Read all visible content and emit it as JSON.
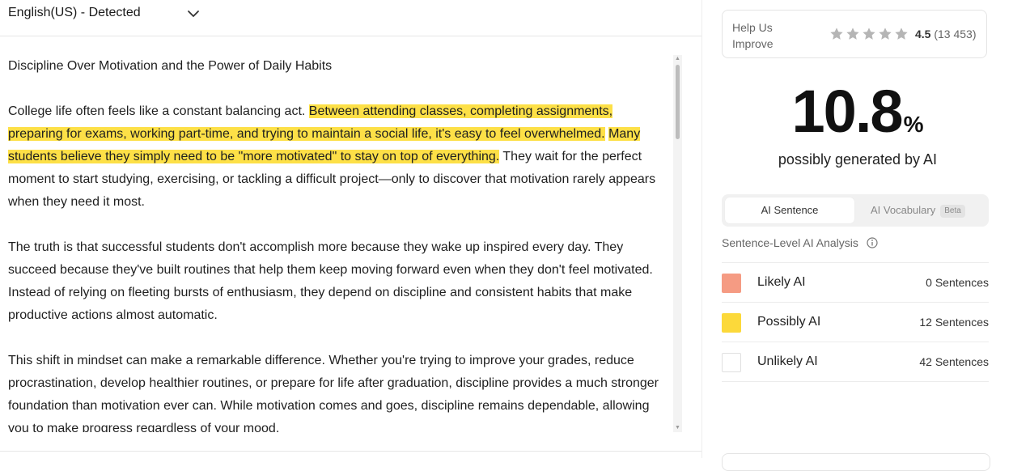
{
  "language": {
    "label": "English(US) - Detected"
  },
  "document": {
    "title": "Discipline Over Motivation and the Power of Daily Habits",
    "p1": {
      "s1": "College life often feels like a constant balancing act. ",
      "s2": "Between attending classes, completing assignments, preparing for exams, working part-time, and trying to maintain a social life, it's easy to feel overwhelmed.",
      "s3": " ",
      "s4": "Many students believe they simply need to be \"more motivated\" to stay on top of everything.",
      "s5": " They wait for the perfect moment to start studying, exercising, or tackling a difficult project—only to discover that motivation rarely appears when they need it most."
    },
    "p2": "The truth is that successful students don't accomplish more because they wake up inspired every day. They succeed because they've built routines that help them keep moving forward even when they don't feel motivated. Instead of relying on fleeting bursts of enthusiasm, they depend on discipline and consistent habits that make productive actions almost automatic.",
    "p3": "This shift in mindset can make a remarkable difference. Whether you're trying to improve your grades, reduce procrastination, develop healthier routines, or prepare for life after graduation, discipline provides a much stronger foundation than motivation ever can. While motivation comes and goes, discipline remains dependable, allowing you to make progress regardless of your mood."
  },
  "feedback": {
    "label": "Help Us Improve",
    "rating_value": "4.5",
    "rating_count": "(13 453)",
    "stars": 5,
    "star_color": "#b5b5b5"
  },
  "score": {
    "value": "10.8",
    "unit": "%",
    "caption": "possibly generated by AI"
  },
  "tabs": {
    "active": "AI Sentence",
    "inactive": "AI Vocabulary",
    "badge": "Beta"
  },
  "analysis": {
    "title": "Sentence-Level AI Analysis",
    "rows": [
      {
        "label": "Likely AI",
        "count": "0 Sentences",
        "color": "#f59b83"
      },
      {
        "label": "Possibly AI",
        "count": "12 Sentences",
        "color": "#fcd93a"
      },
      {
        "label": "Unlikely AI",
        "count": "42 Sentences",
        "color": "#ffffff"
      }
    ]
  },
  "colors": {
    "highlight": "#fde047",
    "text": "#1f1f1f"
  }
}
